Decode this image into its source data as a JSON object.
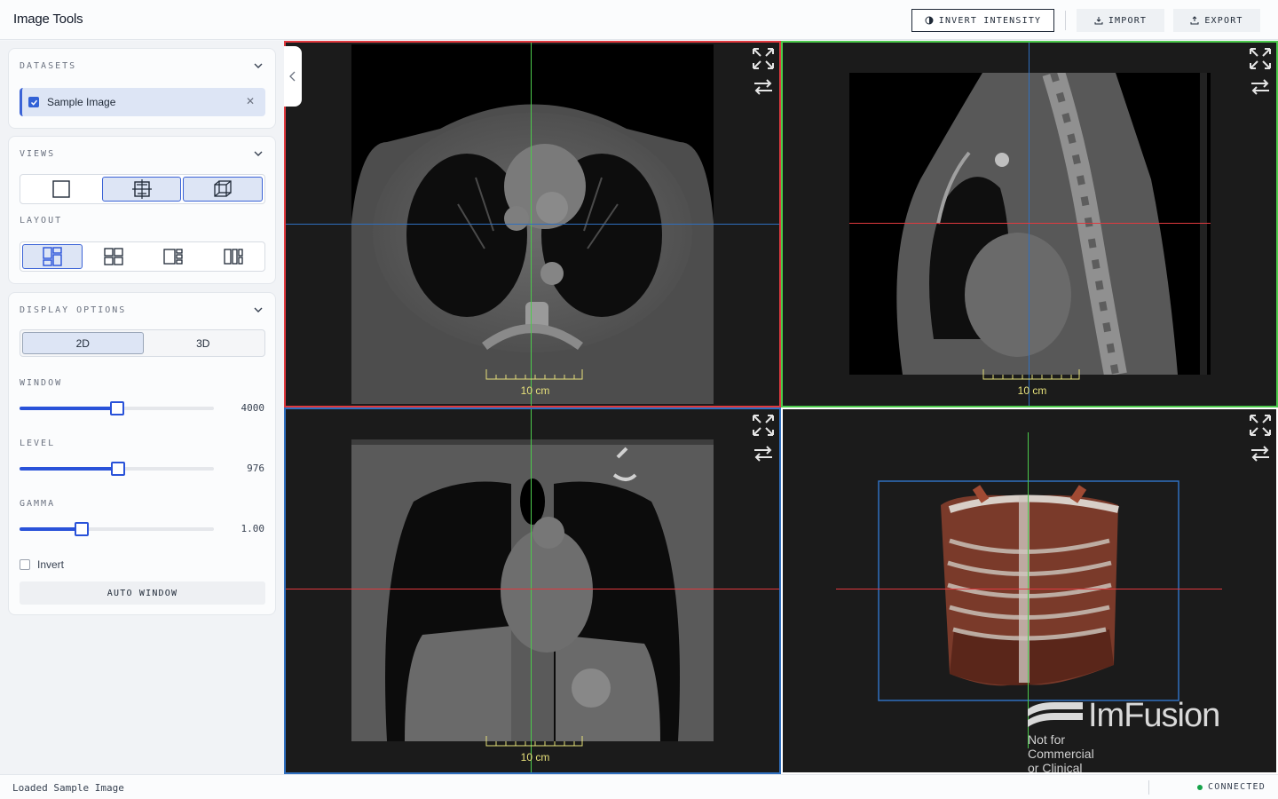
{
  "header": {
    "title": "Image Tools",
    "invert_label": "INVERT INTENSITY",
    "import_label": "IMPORT",
    "export_label": "EXPORT"
  },
  "datasets": {
    "title": "DATASETS",
    "items": [
      {
        "label": "Sample Image",
        "checked": true
      }
    ]
  },
  "views": {
    "title": "VIEWS",
    "options": [
      "single-view-icon",
      "crosshair-view-icon",
      "3d-cube-view-icon"
    ],
    "layout_title": "LAYOUT",
    "layouts": [
      "layout-1-icon",
      "layout-2-icon",
      "layout-3-icon",
      "layout-4-icon"
    ]
  },
  "display": {
    "title": "DISPLAY OPTIONS",
    "modes": [
      "2D",
      "3D"
    ],
    "active_mode": "2D",
    "window": {
      "label": "WINDOW",
      "value": "4000",
      "fraction": 0.5
    },
    "level": {
      "label": "LEVEL",
      "value": "976",
      "fraction": 0.505
    },
    "gamma": {
      "label": "GAMMA",
      "value": "1.00",
      "fraction": 0.32
    },
    "invert_label": "Invert",
    "auto_window_label": "AUTO WINDOW"
  },
  "viewports": {
    "scale_label": "10 cm",
    "watermark_logo": "ImFusion",
    "watermark_note": "Not for Commercial or Clinical Use",
    "colors": {
      "axial": "#e0393e",
      "sagittal": "#4cc94c",
      "coronal": "#2f6fbf",
      "volume": "#ffffff"
    }
  },
  "status": {
    "message": "Loaded Sample Image",
    "connection": "CONNECTED"
  }
}
